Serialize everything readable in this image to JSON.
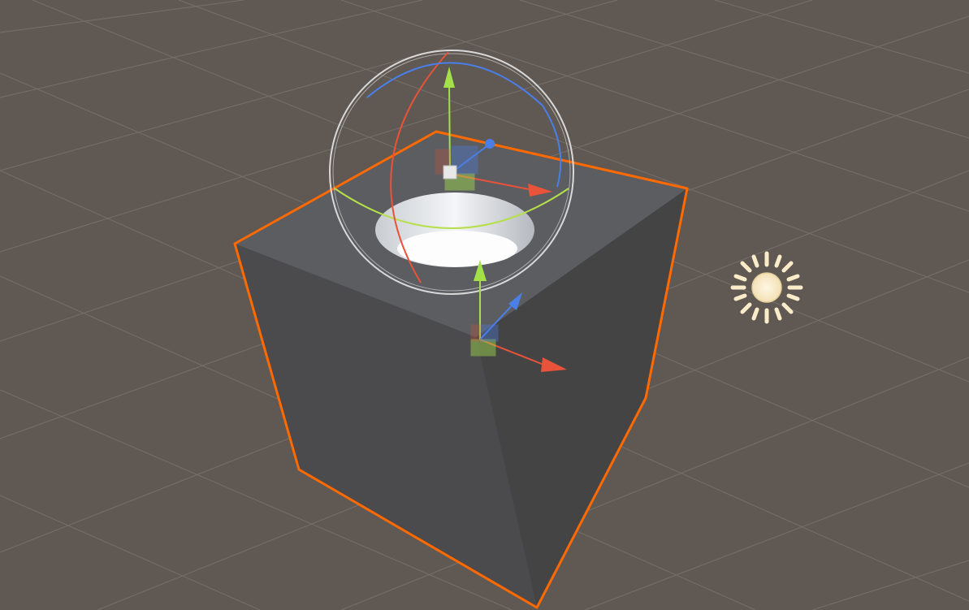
{
  "scene": {
    "background_color": "#5f5853",
    "grid_color": "#7a7470",
    "selected_object": "cube",
    "objects": [
      {
        "name": "cube",
        "selected": true,
        "outline_color": "#ff6a00",
        "face_top": "#5b5d61",
        "face_left": "#4b4a4c",
        "face_right": "#454445"
      },
      {
        "name": "hole",
        "color": "#f2f4f6"
      },
      {
        "name": "directional-light",
        "icon": "sun-icon",
        "color": "#fbecc9"
      }
    ]
  },
  "gizmos": {
    "move_tool": {
      "x_axis_color": "#e8533a",
      "y_axis_color": "#a3e04a",
      "z_axis_color": "#4a7fe8"
    },
    "rotate_tool": {
      "outer_ring_color": "#d9d9d9",
      "x_ring_color": "#e8533a",
      "y_ring_color": "#b5e04a",
      "z_ring_color": "#4a7fe8"
    }
  }
}
